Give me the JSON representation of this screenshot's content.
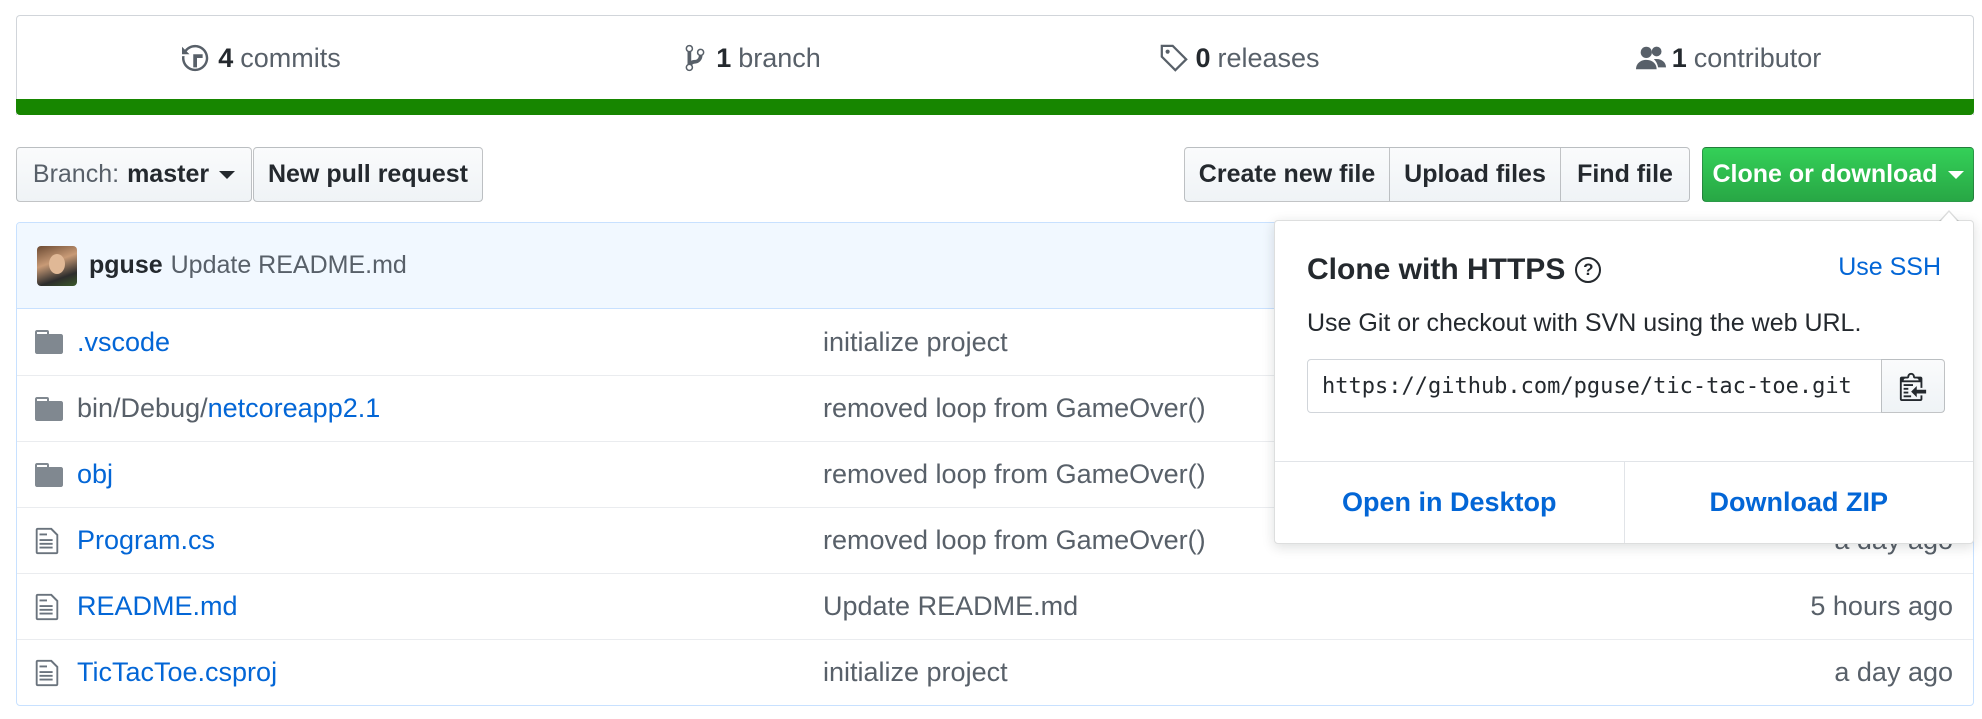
{
  "summary": {
    "commits": {
      "num": "4",
      "label": "commits"
    },
    "branches": {
      "num": "1",
      "label": "branch"
    },
    "releases": {
      "num": "0",
      "label": "releases"
    },
    "contributors": {
      "num": "1",
      "label": "contributor"
    },
    "language_color": "#178600"
  },
  "toolbar": {
    "branch_prefix": "Branch:",
    "branch_name": "master",
    "new_pr_label": "New pull request",
    "create_file_label": "Create new file",
    "upload_files_label": "Upload files",
    "find_file_label": "Find file",
    "clone_label": "Clone or download"
  },
  "commit": {
    "author": "pguse",
    "message": "Update README.md"
  },
  "files": [
    {
      "type": "folder",
      "prefix": "",
      "name": ".vscode",
      "message": "initialize project",
      "age": ""
    },
    {
      "type": "folder",
      "prefix": "bin/Debug/",
      "name": "netcoreapp2.1",
      "message": "removed loop from GameOver()",
      "age": ""
    },
    {
      "type": "folder",
      "prefix": "",
      "name": "obj",
      "message": "removed loop from GameOver()",
      "age": ""
    },
    {
      "type": "file",
      "prefix": "",
      "name": "Program.cs",
      "message": "removed loop from GameOver()",
      "age": "a day ago"
    },
    {
      "type": "file",
      "prefix": "",
      "name": "README.md",
      "message": "Update README.md",
      "age": "5 hours ago"
    },
    {
      "type": "file",
      "prefix": "",
      "name": "TicTacToe.csproj",
      "message": "initialize project",
      "age": "a day ago"
    }
  ],
  "clone": {
    "title": "Clone with HTTPS",
    "help_glyph": "?",
    "use_ssh_label": "Use SSH",
    "description": "Use Git or checkout with SVN using the web URL.",
    "url": "https://github.com/pguse/tic-tac-toe.git",
    "open_desktop_label": "Open in Desktop",
    "download_zip_label": "Download ZIP"
  },
  "colors": {
    "link": "#0366d6",
    "primary_button": "#28a745",
    "muted_text": "#586069"
  }
}
